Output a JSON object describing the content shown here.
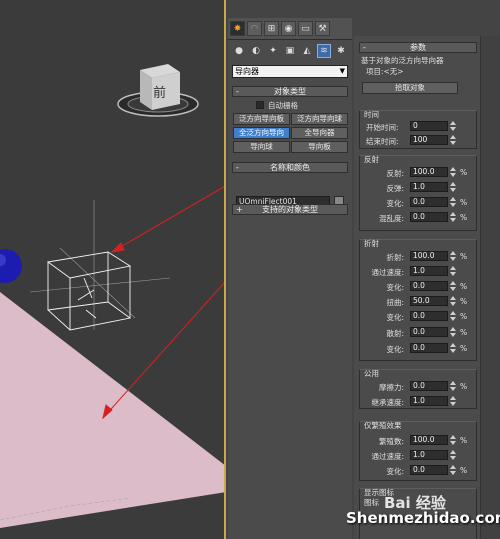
{
  "viewport": {
    "viewcube_label": "前"
  },
  "command_panel": {
    "tabs": [
      {
        "icon": "create-icon",
        "glyph": "✸"
      },
      {
        "icon": "modify-icon",
        "glyph": "◠"
      },
      {
        "icon": "hierarchy-icon",
        "glyph": "⊞"
      },
      {
        "icon": "motion-icon",
        "glyph": "◉"
      },
      {
        "icon": "display-icon",
        "glyph": "▭"
      },
      {
        "icon": "utilities-icon",
        "glyph": "⚒"
      }
    ],
    "subtools": [
      {
        "icon": "geometry-icon",
        "glyph": "●"
      },
      {
        "icon": "shapes-icon",
        "glyph": "◐"
      },
      {
        "icon": "lights-icon",
        "glyph": "✦"
      },
      {
        "icon": "cameras-icon",
        "glyph": "▣"
      },
      {
        "icon": "helpers-icon",
        "glyph": "◭"
      },
      {
        "icon": "space-warps-icon",
        "glyph": "≋"
      },
      {
        "icon": "systems-icon",
        "glyph": "✱"
      }
    ],
    "category_dropdown": "导向器",
    "object_type": {
      "title": "对象类型",
      "sign": "-",
      "autogrid_label": "自动栅格",
      "buttons": [
        "泛方向导向板",
        "泛方向导向球",
        "全泛方向导向",
        "全导向器",
        "导向球",
        "导向板"
      ],
      "selected_index": 2
    },
    "name_color": {
      "title": "名称和颜色",
      "sign": "-",
      "name_value": "UOmniFlect001"
    },
    "supported_types": {
      "title": "支持的对象类型",
      "sign": "+"
    }
  },
  "params": {
    "title": "参数",
    "sign": "-",
    "desc": "基于对象的泛方向导向器",
    "item_label": "项目:<无>",
    "pick_button": "拾取对象",
    "timing": {
      "title": "时间",
      "start_label": "开始时间:",
      "start_value": "0",
      "end_label": "结束时间:",
      "end_value": "100"
    },
    "reflection": {
      "title": "反射",
      "rows": [
        {
          "label": "反射:",
          "value": "100.0",
          "unit": "%"
        },
        {
          "label": "反弹:",
          "value": "1.0",
          "unit": ""
        },
        {
          "label": "变化:",
          "value": "0.0",
          "unit": "%"
        },
        {
          "label": "混乱度:",
          "value": "0.0",
          "unit": "%"
        }
      ]
    },
    "refraction": {
      "title": "折射",
      "rows": [
        {
          "label": "折射:",
          "value": "100.0",
          "unit": "%"
        },
        {
          "label": "通过速度:",
          "value": "1.0",
          "unit": ""
        },
        {
          "label": "变化:",
          "value": "0.0",
          "unit": "%"
        },
        {
          "label": "扭曲:",
          "value": "50.0",
          "unit": "%"
        },
        {
          "label": "变化:",
          "value": "0.0",
          "unit": "%"
        },
        {
          "label": "散射:",
          "value": "0.0",
          "unit": "%"
        },
        {
          "label": "变化:",
          "value": "0.0",
          "unit": "%"
        }
      ]
    },
    "common": {
      "title": "公用",
      "rows": [
        {
          "label": "摩擦力:",
          "value": "0.0",
          "unit": "%"
        },
        {
          "label": "继承速度:",
          "value": "1.0",
          "unit": ""
        }
      ]
    },
    "spawn": {
      "title": "仅繁殖效果",
      "rows": [
        {
          "label": "繁殖数:",
          "value": "100.0",
          "unit": "%"
        },
        {
          "label": "通过速度:",
          "value": "1.0",
          "unit": ""
        },
        {
          "label": "变化:",
          "value": "0.0",
          "unit": "%"
        }
      ]
    },
    "display_icon": {
      "title": "显示图标",
      "icon_label": "图标"
    }
  },
  "watermark": {
    "brand": "Bai 经验",
    "url": "Shenmezhidao.com"
  },
  "colors": {
    "plane": "#dcbcc8",
    "sphere": "#1c1cb0",
    "arrow": "#d82020",
    "selected": "#3f7fce",
    "frame_border": "#c8a84a"
  }
}
